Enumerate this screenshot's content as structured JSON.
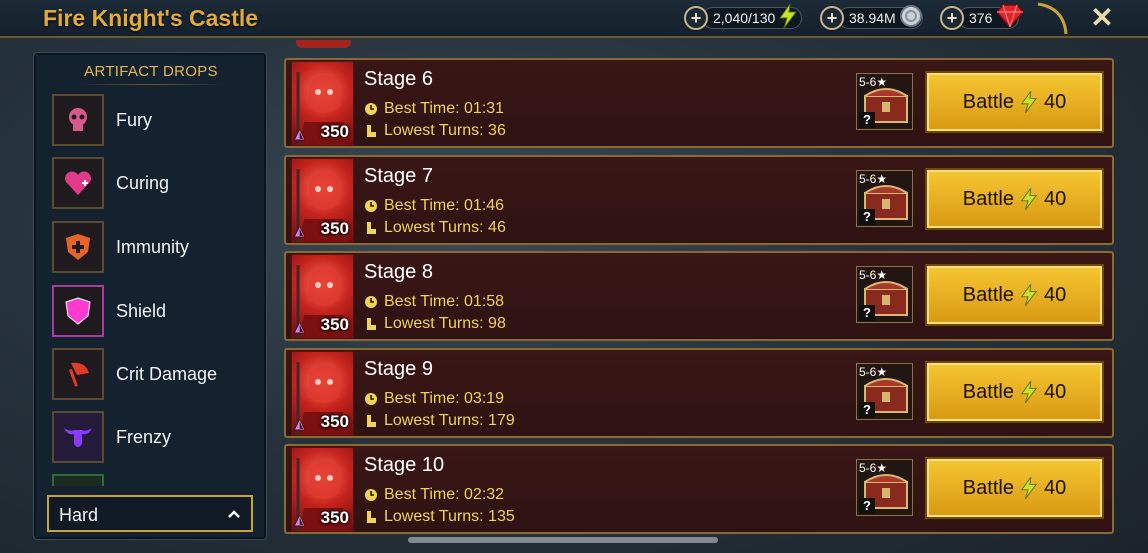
{
  "header": {
    "title": "Fire Knight's Castle",
    "resources": [
      {
        "label": "2,040/130",
        "icon": "energy-bolt-icon"
      },
      {
        "label": "38.94M",
        "icon": "silver-coin-icon"
      },
      {
        "label": "376",
        "icon": "ruby-gem-icon"
      }
    ],
    "close_icon": "close-icon"
  },
  "sidebar": {
    "heading": "ARTIFACT DROPS",
    "items": [
      {
        "label": "Fury",
        "icon": "fury-skull-icon",
        "color": "#d85a8a"
      },
      {
        "label": "Curing",
        "icon": "curing-heart-icon",
        "color": "#e23a8a"
      },
      {
        "label": "Immunity",
        "icon": "immunity-shield-cross-icon",
        "color": "#e8632a"
      },
      {
        "label": "Shield",
        "icon": "shield-icon",
        "color": "#ff3ad0"
      },
      {
        "label": "Crit Damage",
        "icon": "crit-damage-axe-icon",
        "color": "#e03a2a"
      },
      {
        "label": "Frenzy",
        "icon": "frenzy-bull-icon",
        "color": "#8a3aff"
      }
    ],
    "difficulty": "Hard"
  },
  "stages": [
    {
      "name": "Stage 6",
      "best_time": "Best Time: 01:31",
      "lowest_turns": "Lowest Turns: 36",
      "level": "350",
      "chest_stars": "5-6★",
      "battle_label": "Battle",
      "cost": "40"
    },
    {
      "name": "Stage 7",
      "best_time": "Best Time: 01:46",
      "lowest_turns": "Lowest Turns: 46",
      "level": "350",
      "chest_stars": "5-6★",
      "battle_label": "Battle",
      "cost": "40"
    },
    {
      "name": "Stage 8",
      "best_time": "Best Time: 01:58",
      "lowest_turns": "Lowest Turns: 98",
      "level": "350",
      "chest_stars": "5-6★",
      "battle_label": "Battle",
      "cost": "40"
    },
    {
      "name": "Stage 9",
      "best_time": "Best Time: 03:19",
      "lowest_turns": "Lowest Turns: 179",
      "level": "350",
      "chest_stars": "5-6★",
      "battle_label": "Battle",
      "cost": "40"
    },
    {
      "name": "Stage 10",
      "best_time": "Best Time: 02:32",
      "lowest_turns": "Lowest Turns: 135",
      "level": "350",
      "chest_stars": "5-6★",
      "battle_label": "Battle",
      "cost": "40"
    }
  ],
  "colors": {
    "accent_gold": "#e2a93c",
    "battle_button": "#f0b823",
    "stat_text": "#f0d45a"
  }
}
